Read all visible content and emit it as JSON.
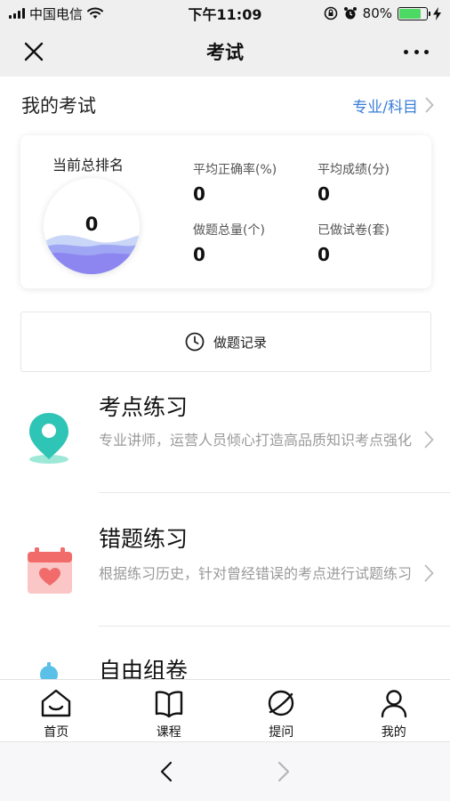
{
  "status_bar": {
    "carrier": "中国电信",
    "time": "下午11:09",
    "battery": "80%",
    "battery_level": 0.8
  },
  "nav": {
    "title": "考试",
    "close_icon": "close-icon",
    "more_icon": "more-icon"
  },
  "my_exam": {
    "title": "我的考试",
    "link_label": "专业/科目"
  },
  "stats": {
    "rank_label": "当前总排名",
    "rank_value": "0",
    "items": [
      {
        "label": "平均正确率(%)",
        "value": "0"
      },
      {
        "label": "平均成绩(分)",
        "value": "0"
      },
      {
        "label": "做题总量(个)",
        "value": "0"
      },
      {
        "label": "已做试卷(套)",
        "value": "0"
      }
    ]
  },
  "record": {
    "label": "做题记录",
    "icon": "clock-icon"
  },
  "practice_items": [
    {
      "title": "考点练习",
      "desc": "专业讲师，运营人员倾心打造高品质知识考点强化",
      "icon": "location-pin-icon"
    },
    {
      "title": "错题练习",
      "desc": "根据练习历史，针对曾经错误的考点进行试题练习",
      "icon": "calendar-heart-icon"
    },
    {
      "title": "自由组卷",
      "desc": "",
      "icon": "bulb-icon"
    }
  ],
  "tabs": [
    {
      "label": "首页",
      "icon": "home-icon"
    },
    {
      "label": "课程",
      "icon": "book-icon"
    },
    {
      "label": "提问",
      "icon": "planet-icon"
    },
    {
      "label": "我的",
      "icon": "user-icon"
    }
  ],
  "colors": {
    "accent_blue": "#3a7ed8",
    "wave_purple": "#8e86f0",
    "pin_teal": "#2ec4b6",
    "calendar_red": "#f26b6b",
    "battery_green": "#4cd964"
  }
}
